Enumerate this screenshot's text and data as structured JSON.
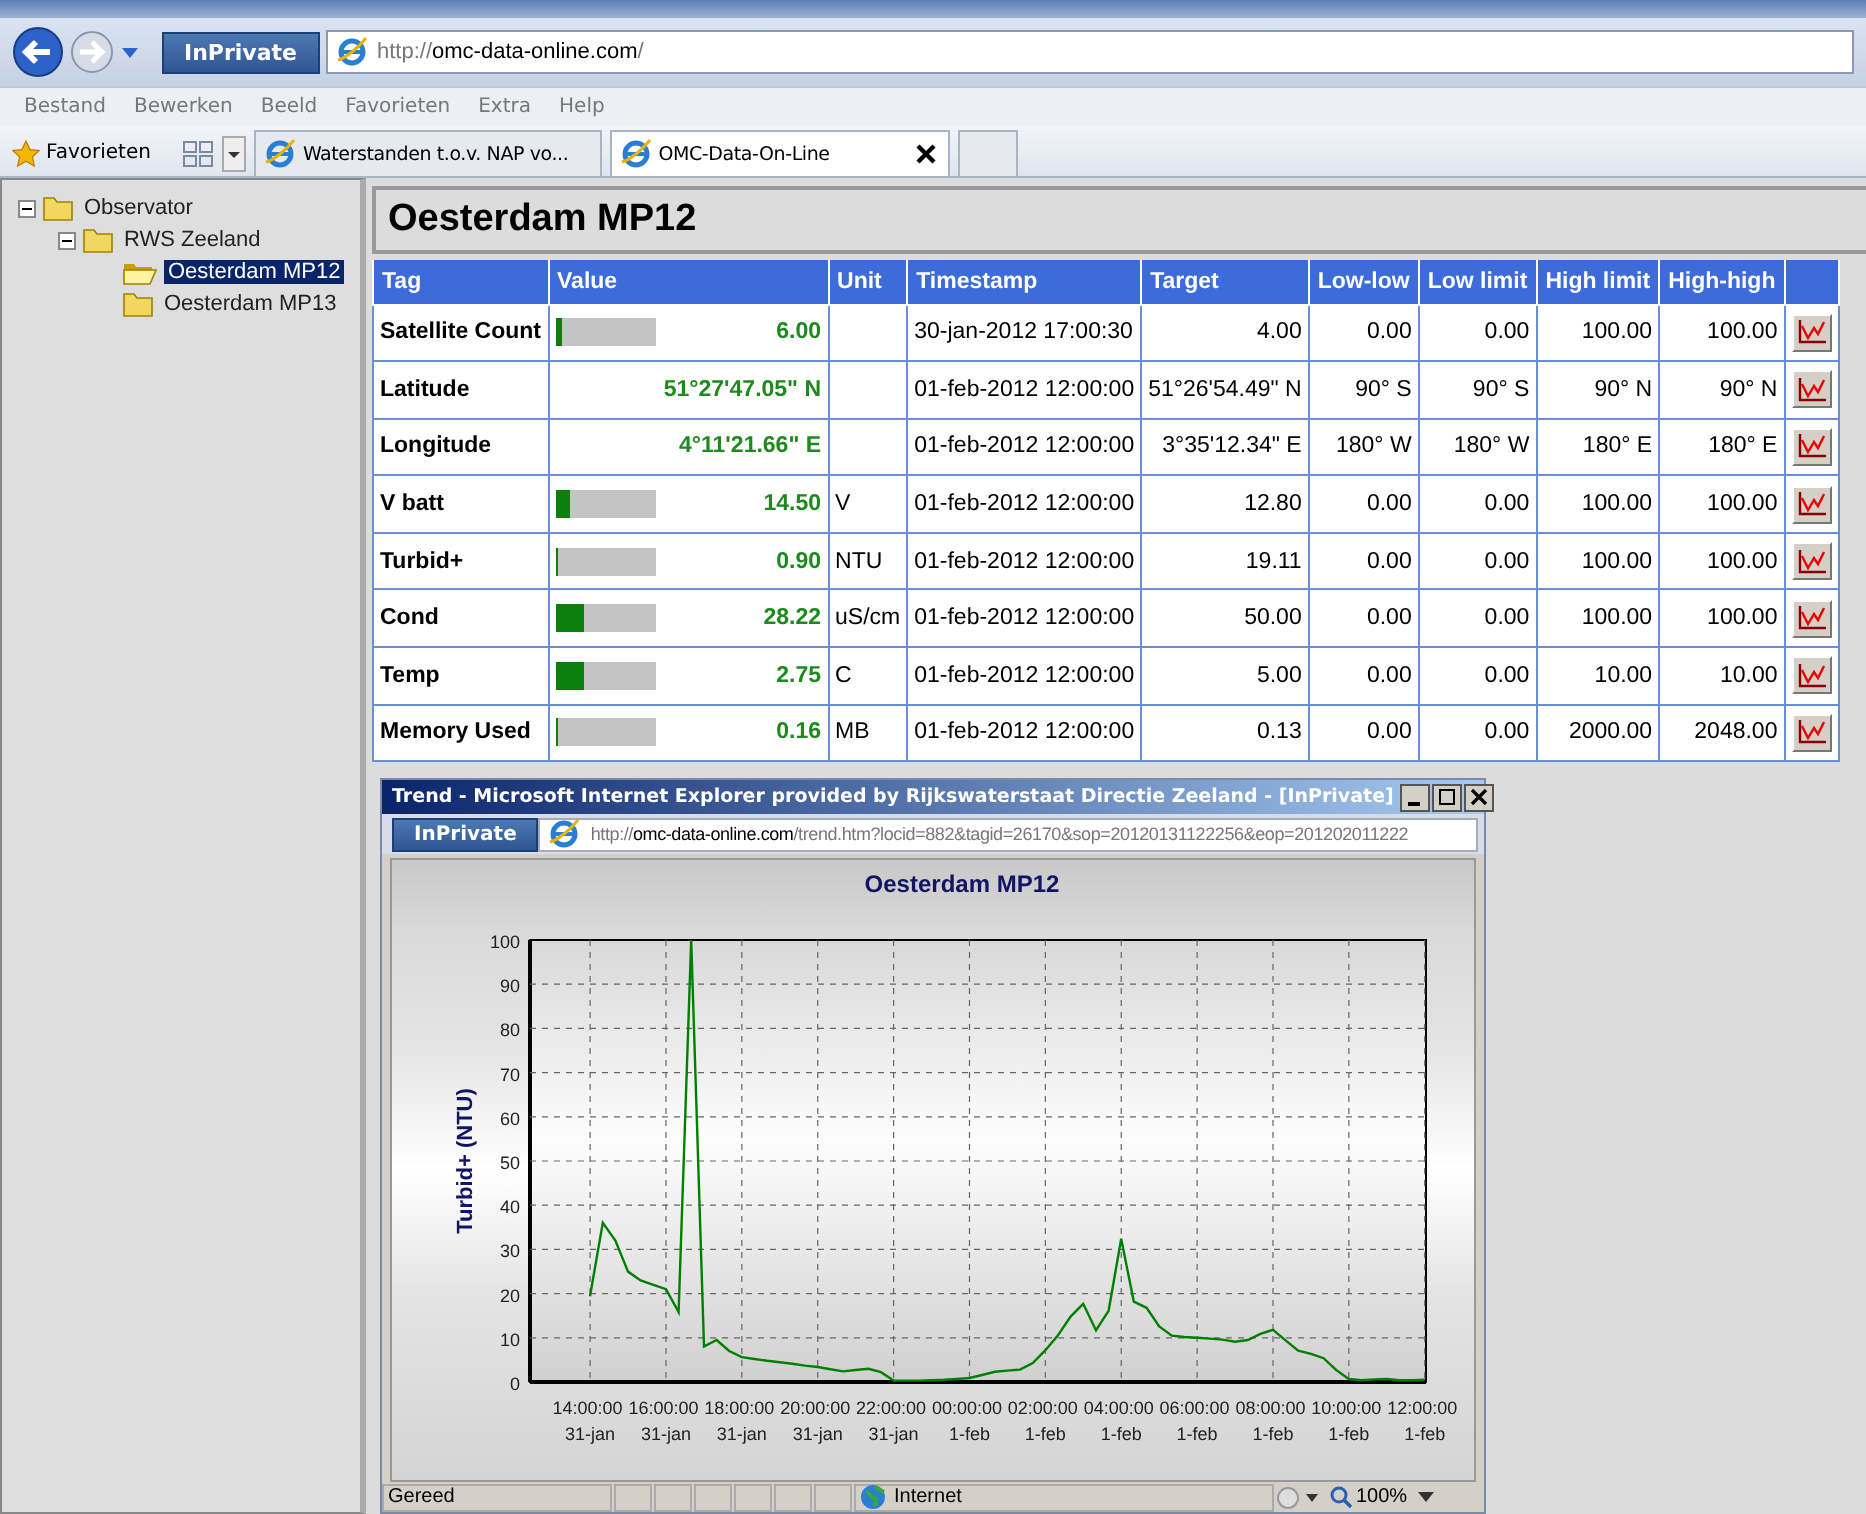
{
  "browser": {
    "inprivate": "InPrivate",
    "address": {
      "scheme": "http://",
      "host": "omc-data-online.com",
      "path": "/"
    },
    "menu": [
      "Bestand",
      "Bewerken",
      "Beeld",
      "Favorieten",
      "Extra",
      "Help"
    ],
    "favorites": "Favorieten",
    "tabs": [
      {
        "label": "Waterstanden t.o.v. NAP vo...",
        "selected": false
      },
      {
        "label": "OMC-Data-On-Line",
        "selected": true
      }
    ]
  },
  "tree": [
    {
      "label": "Observator",
      "expanded": true,
      "selected": false,
      "children": [
        {
          "label": "RWS Zeeland",
          "expanded": true,
          "selected": false,
          "children": [
            {
              "label": "Oesterdam MP12",
              "selected": true
            },
            {
              "label": "Oesterdam MP13",
              "selected": false
            }
          ]
        }
      ]
    }
  ],
  "page_title": "Oesterdam MP12",
  "table": {
    "columns": [
      "Tag",
      "Value",
      "Unit",
      "Timestamp",
      "Target",
      "Low-low",
      "Low limit",
      "High limit",
      "High-high"
    ],
    "rows": [
      {
        "tag": "Satellite Count",
        "kind": "bar",
        "level": 0.06,
        "value": "6.00",
        "unit": "",
        "timestamp": "30-jan-2012 17:00:30",
        "target": "4.00",
        "low_low": "0.00",
        "low_limit": "0.00",
        "high_limit": "100.00",
        "high_high": "100.00"
      },
      {
        "tag": "Latitude",
        "kind": "text",
        "value": "51°27'47.05\" N",
        "unit": "",
        "timestamp": "01-feb-2012 12:00:00",
        "target": "51°26'54.49\" N",
        "low_low": "90° S",
        "low_limit": "90° S",
        "high_limit": "90° N",
        "high_high": "90° N"
      },
      {
        "tag": "Longitude",
        "kind": "text",
        "value": "4°11'21.66\" E",
        "unit": "",
        "timestamp": "01-feb-2012 12:00:00",
        "target": "3°35'12.34\" E",
        "low_low": "180° W",
        "low_limit": "180° W",
        "high_limit": "180° E",
        "high_high": "180° E"
      },
      {
        "tag": "V batt",
        "kind": "bar",
        "level": 0.145,
        "value": "14.50",
        "unit": "V",
        "timestamp": "01-feb-2012 12:00:00",
        "target": "12.80",
        "low_low": "0.00",
        "low_limit": "0.00",
        "high_limit": "100.00",
        "high_high": "100.00"
      },
      {
        "tag": "Turbid+",
        "kind": "bar",
        "level": 0.01,
        "value": "0.90",
        "unit": "NTU",
        "timestamp": "01-feb-2012 12:00:00",
        "target": "19.11",
        "low_low": "0.00",
        "low_limit": "0.00",
        "high_limit": "100.00",
        "high_high": "100.00"
      },
      {
        "tag": "Cond",
        "kind": "bar",
        "level": 0.28,
        "value": "28.22",
        "unit": "uS/cm",
        "timestamp": "01-feb-2012 12:00:00",
        "target": "50.00",
        "low_low": "0.00",
        "low_limit": "0.00",
        "high_limit": "100.00",
        "high_high": "100.00"
      },
      {
        "tag": "Temp",
        "kind": "bar",
        "level": 0.28,
        "value": "2.75",
        "unit": "C",
        "timestamp": "01-feb-2012 12:00:00",
        "target": "5.00",
        "low_low": "0.00",
        "low_limit": "0.00",
        "high_limit": "10.00",
        "high_high": "10.00"
      },
      {
        "tag": "Memory Used",
        "kind": "bar",
        "level": 0,
        "value": "0.16",
        "unit": "MB",
        "timestamp": "01-feb-2012 12:00:00",
        "target": "0.13",
        "low_low": "0.00",
        "low_limit": "0.00",
        "high_limit": "2000.00",
        "high_high": "2048.00"
      }
    ]
  },
  "popup": {
    "title": "Trend - Microsoft Internet Explorer provided by Rijkswaterstaat Directie Zeeland - [InPrivate]",
    "inprivate": "InPrivate",
    "address": {
      "scheme": "http://",
      "host": "omc-data-online.com",
      "path": "/trend.htm?locid=882&tagid=26170&sop=20120131122256&eop=201202011222"
    },
    "chart_data": {
      "type": "line",
      "title": "Oesterdam MP12",
      "ylabel": "Turbid+ (NTU)",
      "grid": true,
      "ylim": [
        0,
        100
      ],
      "yticks": [
        0,
        10,
        20,
        30,
        40,
        50,
        60,
        70,
        80,
        90,
        100
      ],
      "categories": [
        "14:00:00 31-jan",
        null,
        null,
        null,
        null,
        null,
        "16:00:00 31-jan",
        null,
        null,
        null,
        null,
        null,
        "18:00:00 31-jan",
        null,
        null,
        null,
        null,
        null,
        "20:00:00 31-jan",
        null,
        null,
        null,
        null,
        null,
        "22:00:00 31-jan",
        null,
        null,
        null,
        null,
        null,
        "00:00:00 1-feb",
        null,
        null,
        null,
        null,
        null,
        "02:00:00 1-feb",
        null,
        null,
        null,
        null,
        null,
        "04:00:00 1-feb",
        null,
        null,
        null,
        null,
        null,
        "06:00:00 1-feb",
        null,
        null,
        null,
        null,
        null,
        "08:00:00 1-feb",
        null,
        null,
        null,
        null,
        null,
        "10:00:00 1-feb",
        null,
        null,
        null,
        null,
        null,
        "12:00:00 1-feb"
      ],
      "series": [
        {
          "color": "#008000",
          "values": [
            19.4,
            36,
            32,
            25,
            23,
            22,
            21,
            15.8,
            100,
            8,
            9.5,
            7,
            5.6,
            5.2,
            4.8,
            4.5,
            4.1,
            3.7,
            3.4,
            2.9,
            2.4,
            2.7,
            3.0,
            2.2,
            0.3,
            0.3,
            0.3,
            0.4,
            0.5,
            0.7,
            0.9,
            1.6,
            2.3,
            2.6,
            2.8,
            4.3,
            7.2,
            10.6,
            14.8,
            17.7,
            11.7,
            16.1,
            32.4,
            18.2,
            16.8,
            12.6,
            10.5,
            10.2,
            10,
            9.8,
            9.6,
            9.1,
            9.5,
            10.9,
            11.8,
            9.4,
            7.1,
            6.4,
            5.4,
            2.7,
            0.7,
            0.4,
            0.6,
            0.7,
            0.4,
            0.4,
            0.5
          ]
        }
      ]
    },
    "status_bar": {
      "text": "Gereed",
      "zone": "Internet",
      "zoom": "100%"
    }
  }
}
